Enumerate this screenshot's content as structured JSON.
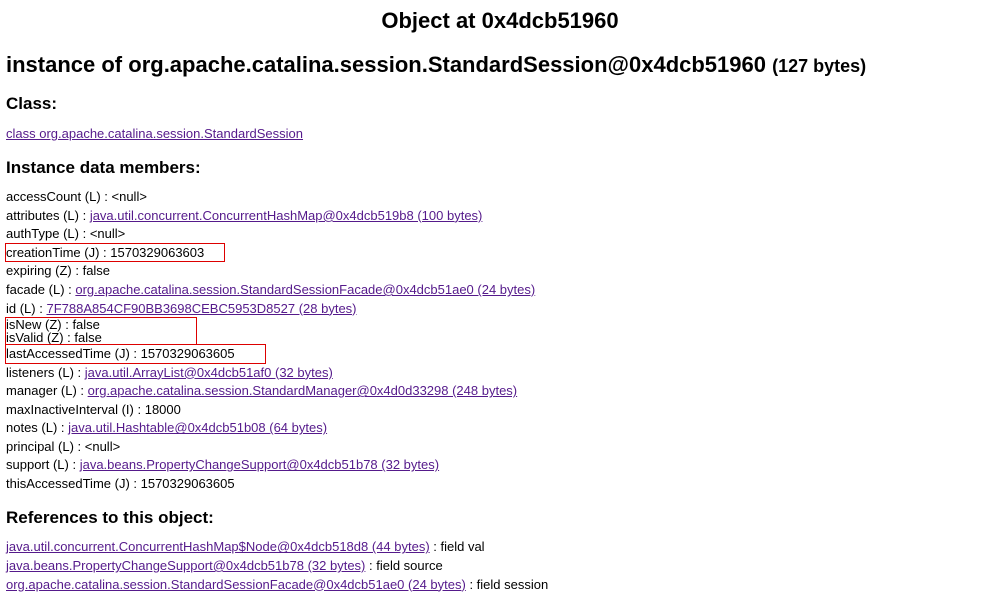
{
  "title": "Object at 0x4dcb51960",
  "instanceOfPrefix": "instance of ",
  "instanceClassDesc": "org.apache.catalina.session.StandardSession@0x4dcb51960",
  "instanceBytes": "(127 bytes)",
  "sectionClass": "Class:",
  "classLink": "class org.apache.catalina.session.StandardSession",
  "sectionMembers": "Instance data members:",
  "members": {
    "accessCount": {
      "label": "accessCount (L) : ",
      "value": "<null>"
    },
    "attributes": {
      "label": "attributes (L) : ",
      "link": "java.util.concurrent.ConcurrentHashMap@0x4dcb519b8 (100 bytes)"
    },
    "authType": {
      "label": "authType (L) : ",
      "value": "<null>"
    },
    "creationTime": {
      "text": "creationTime (J) : 1570329063603"
    },
    "expiring": {
      "label": "expiring (Z) : ",
      "value": "false"
    },
    "facade": {
      "label": "facade (L) : ",
      "link": "org.apache.catalina.session.StandardSessionFacade@0x4dcb51ae0 (24 bytes)"
    },
    "id": {
      "label": "id (L) : ",
      "link": "7F788A854CF90BB3698CEBC5953D8527 (28 bytes)"
    },
    "isNew": {
      "text": "isNew (Z) : false"
    },
    "isValid": {
      "text": "isValid (Z) : false"
    },
    "lastAccessedTime": {
      "text": "lastAccessedTime (J) : 1570329063605"
    },
    "listeners": {
      "label": "listeners (L) : ",
      "link": "java.util.ArrayList@0x4dcb51af0 (32 bytes)"
    },
    "manager": {
      "label": "manager (L) : ",
      "link": "org.apache.catalina.session.StandardManager@0x4d0d33298 (248 bytes)"
    },
    "maxInactiveInterval": {
      "label": "maxInactiveInterval (I) : ",
      "value": "18000"
    },
    "notes": {
      "label": "notes (L) : ",
      "link": "java.util.Hashtable@0x4dcb51b08 (64 bytes)"
    },
    "principal": {
      "label": "principal (L) : ",
      "value": "<null>"
    },
    "support": {
      "label": "support (L) : ",
      "link": "java.beans.PropertyChangeSupport@0x4dcb51b78 (32 bytes)"
    },
    "thisAccessedTime": {
      "label": "thisAccessedTime (J) : ",
      "value": "1570329063605"
    }
  },
  "sectionRefs": "References to this object:",
  "refs": {
    "r1": {
      "link": "java.util.concurrent.ConcurrentHashMap$Node@0x4dcb518d8 (44 bytes)",
      "suffix": " : field val"
    },
    "r2": {
      "link": "java.beans.PropertyChangeSupport@0x4dcb51b78 (32 bytes)",
      "suffix": " : field source"
    },
    "r3": {
      "link": "org.apache.catalina.session.StandardSessionFacade@0x4dcb51ae0 (24 bytes)",
      "suffix": " : field session"
    }
  }
}
